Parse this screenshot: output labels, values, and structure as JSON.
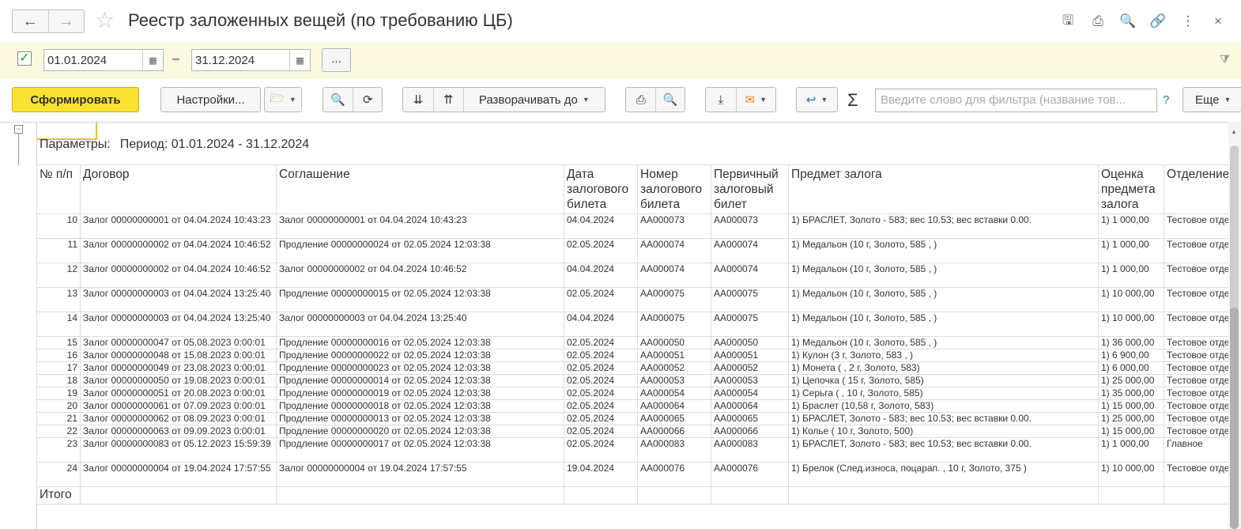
{
  "window": {
    "title": "Реестр заложенных вещей (по требованию ЦБ)",
    "back_icon": "←",
    "forward_icon": "→",
    "star_icon": "☆",
    "icons": [
      "save-icon",
      "print-icon",
      "preview-icon",
      "link-icon",
      "more-icon",
      "close-icon"
    ],
    "icon_glyphs": [
      "🖫",
      "⎙",
      "🔍",
      "🔗",
      "⋮",
      "×"
    ]
  },
  "period": {
    "checked": true,
    "check_glyph": "✓",
    "date_from": "01.01.2024",
    "date_to": "31.12.2024",
    "dash": "–",
    "more_label": "...",
    "cal_glyph": "▦",
    "filter_glyph": "⧩"
  },
  "toolbar": {
    "generate_label": "Сформировать",
    "settings_label": "Настройки...",
    "expand_label": "Разворачивать до",
    "search_placeholder": "Введите слово для фильтра (название тов...",
    "help_label": "?",
    "more_label": "Еще",
    "sigma": "Σ"
  },
  "report": {
    "params_label": "Параметры:",
    "params_value": "Период: 01.01.2024 - 31.12.2024",
    "columns": [
      "№ п/п",
      "Договор",
      "Соглашение",
      "Дата залогового билета",
      "Номер залогового билета",
      "Первичный залоговый билет",
      "Предмет залога",
      "Оценка предмета залога",
      "Отделение"
    ],
    "rows": [
      {
        "n": "10",
        "contract": "Залог 00000000001 от 04.04.2024 10:43:23",
        "agreement": "Залог 00000000001 от 04.04.2024 10:43:23",
        "date": "04.04.2024",
        "ticket": "АА000073",
        "primary": "АА000073",
        "item": "1) БРАСЛЕТ, Золото - 583; вес 10.53; вес вставки 0.00.",
        "value": "1) 1 000,00",
        "branch": "Тестовое отделение",
        "tall": true
      },
      {
        "n": "11",
        "contract": "Залог 00000000002 от 04.04.2024 10:46:52",
        "agreement": "Продление 00000000024 от 02.05.2024 12:03:38",
        "date": "02.05.2024",
        "ticket": "АА000074",
        "primary": "АА000074",
        "item": "1) Медальон (10 г, Золото, 585 , )",
        "value": "1) 1 000,00",
        "branch": "Тестовое отделение",
        "tall": true
      },
      {
        "n": "12",
        "contract": "Залог 00000000002 от 04.04.2024 10:46:52",
        "agreement": "Залог 00000000002 от 04.04.2024 10:46:52",
        "date": "04.04.2024",
        "ticket": "АА000074",
        "primary": "АА000074",
        "item": "1) Медальон (10 г, Золото, 585 , )",
        "value": "1) 1 000,00",
        "branch": "Тестовое отделение",
        "tall": true
      },
      {
        "n": "13",
        "contract": "Залог 00000000003 от 04.04.2024 13:25:40",
        "agreement": "Продление 00000000015 от 02.05.2024 12:03:38",
        "date": "02.05.2024",
        "ticket": "АА000075",
        "primary": "АА000075",
        "item": "1) Медальон (10 г, Золото, 585 , )",
        "value": "1) 10 000,00",
        "branch": "Тестовое отделение",
        "tall": true
      },
      {
        "n": "14",
        "contract": "Залог 00000000003 от 04.04.2024 13:25:40",
        "agreement": "Залог 00000000003 от 04.04.2024 13:25:40",
        "date": "04.04.2024",
        "ticket": "АА000075",
        "primary": "АА000075",
        "item": "1) Медальон (10 г, Золото, 585 , )",
        "value": "1) 10 000,00",
        "branch": "Тестовое отделение",
        "tall": true
      },
      {
        "n": "15",
        "contract": "Залог 00000000047 от 05.08.2023 0:00:01",
        "agreement": "Продление 00000000016 от 02.05.2024 12:03:38",
        "date": "02.05.2024",
        "ticket": "АА000050",
        "primary": "АА000050",
        "item": "1) Медальон (10 г, Золото, 585 , )",
        "value": "1) 36 000,00",
        "branch": "Тестовое отделение",
        "tall": false
      },
      {
        "n": "16",
        "contract": "Залог 00000000048 от 15.08.2023 0:00:01",
        "agreement": "Продление 00000000022 от 02.05.2024 12:03:38",
        "date": "02.05.2024",
        "ticket": "АА000051",
        "primary": "АА000051",
        "item": "1) Кулон (3 г, Золото, 583 , )",
        "value": "1) 6 900,00",
        "branch": "Тестовое отделение",
        "tall": false
      },
      {
        "n": "17",
        "contract": "Залог 00000000049 от 23.08.2023 0:00:01",
        "agreement": "Продление 00000000023 от 02.05.2024 12:03:38",
        "date": "02.05.2024",
        "ticket": "АА000052",
        "primary": "АА000052",
        "item": "1) Монета ( , 2 г, Золото, 583)",
        "value": "1) 6 000,00",
        "branch": "Тестовое отделение",
        "tall": false
      },
      {
        "n": "18",
        "contract": "Залог 00000000050 от 19.08.2023 0:00:01",
        "agreement": "Продление 00000000014 от 02.05.2024 12:03:38",
        "date": "02.05.2024",
        "ticket": "АА000053",
        "primary": "АА000053",
        "item": "1) Цепочка (  15 г, Золото, 585)",
        "value": "1) 25 000,00",
        "branch": "Тестовое отделение",
        "tall": false
      },
      {
        "n": "19",
        "contract": "Залог 00000000051 от 20.08.2023 0:00:01",
        "agreement": "Продление 00000000019 от 02.05.2024 12:03:38",
        "date": "02.05.2024",
        "ticket": "АА000054",
        "primary": "АА000054",
        "item": "1) Серьга ( , 10 г, Золото, 585)",
        "value": "1) 35 000,00",
        "branch": "Тестовое отделение",
        "tall": false
      },
      {
        "n": "20",
        "contract": "Залог 00000000061 от 07.09.2023 0:00:01",
        "agreement": "Продление 00000000018 от 02.05.2024 12:03:38",
        "date": "02.05.2024",
        "ticket": "АА000064",
        "primary": "АА000064",
        "item": "1) Браслет (10,58 г, Золото, 583)",
        "value": "1) 15 000,00",
        "branch": "Тестовое отделение",
        "tall": false
      },
      {
        "n": "21",
        "contract": "Залог 00000000062 от 08.09.2023 0:00:01",
        "agreement": "Продление 00000000013 от 02.05.2024 12:03:38",
        "date": "02.05.2024",
        "ticket": "АА000065",
        "primary": "АА000065",
        "item": "1) БРАСЛЕТ, Золото - 583; вес 10.53; вес вставки 0.00.",
        "value": "1) 25 000,00",
        "branch": "Тестовое отделение",
        "tall": false
      },
      {
        "n": "22",
        "contract": "Залог 00000000063 от 09.09.2023 0:00:01",
        "agreement": "Продление 00000000020 от 02.05.2024 12:03:38",
        "date": "02.05.2024",
        "ticket": "АА000066",
        "primary": "АА000066",
        "item": "1) Колье (  10 г, Золото, 500)",
        "value": "1) 15 000,00",
        "branch": "Тестовое отделение",
        "tall": false
      },
      {
        "n": "23",
        "contract": "Залог 00000000083 от 05.12.2023 15:59:39",
        "agreement": "Продление 00000000017 от 02.05.2024 12:03:38",
        "date": "02.05.2024",
        "ticket": "АА000083",
        "primary": "АА000083",
        "item": "1) БРАСЛЕТ, Золото - 583; вес 10.53; вес вставки 0.00.",
        "value": "1) 1 000,00",
        "branch": "Главное",
        "tall": true
      },
      {
        "n": "24",
        "contract": "Залог 00000000004 от 19.04.2024 17:57:55",
        "agreement": "Залог 00000000004 от 19.04.2024 17:57:55",
        "date": "19.04.2024",
        "ticket": "АА000076",
        "primary": "АА000076",
        "item": "1) Брелок (След.износа, поцарап. , 10 г, Золото, 375 )",
        "value": "1) 10 000,00",
        "branch": "Тестовое отделение",
        "tall": true
      }
    ],
    "total_label": "Итого"
  }
}
